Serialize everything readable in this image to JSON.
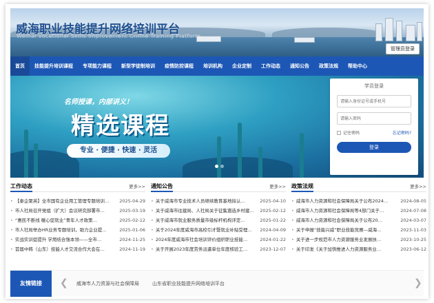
{
  "header": {
    "title": "威海职业技能提升网络培训平台",
    "subtitle": "Weihai Vocational Skills Improvement Online Training Platform",
    "admin_login": "管理员登录"
  },
  "nav": {
    "items": [
      "首页",
      "技能提升培训课程",
      "专项能力课程",
      "新型学徒制培训",
      "疫情防控课程",
      "培训机构",
      "企业定制",
      "工作动态",
      "通知公告",
      "政策法规",
      "帮助中心"
    ],
    "active_index": 0
  },
  "hero": {
    "slogan": "名师授课，内部讲义！",
    "headline": "精选课程",
    "tagline": "专业 · 便捷 · 快速 · 灵活",
    "slide_count": 2,
    "active_slide": 1
  },
  "login": {
    "title": "学员登录",
    "id_placeholder": "请输入身份证号或手机号",
    "password_placeholder": "请输入密码",
    "remember_label": "记住密码",
    "forgot_label": "忘记密码?",
    "submit_label": "登录"
  },
  "columns": [
    {
      "title": "工作动态",
      "more": "更多>>",
      "items": [
        {
          "title": "【泰企聚英】全市国有企业用工管理专题培训…",
          "date": "2025-04-29"
        },
        {
          "title": "市人社局召开党组（扩大）会议研究部署市…",
          "date": "2025-03-19"
        },
        {
          "title": "“惠民不断线 暖心促就业”青年人才政策…",
          "date": "2025-02-12"
        },
        {
          "title": "市人社局举办HR业务专题培训，助力企业提…",
          "date": "2025-01-06"
        },
        {
          "title": "实战实训促提升 学用结合强本领——全市…",
          "date": "2024-11-25"
        },
        {
          "title": "首届中韩（山东）技能人才交流合作大会在…",
          "date": "2024-11-19"
        }
      ]
    },
    {
      "title": "通知公告",
      "more": "更多>>",
      "items": [
        {
          "title": "关于威海市专业技术人员继续教育基地拟认…",
          "date": "2025-04-10"
        },
        {
          "title": "关于威海市往建局、人社局关于征集遴选乡村建…",
          "date": "2025-02-12"
        },
        {
          "title": "关于威海市就业服务质量市级标杆机构评定…",
          "date": "2025-01-22"
        },
        {
          "title": "关于2024年度威海市高校引才暨就业补贴受理…",
          "date": "2024-04-09"
        },
        {
          "title": "2024年度威海市社会培训评价组织职业技能…",
          "date": "2024-01-22"
        },
        {
          "title": "关于开展2023年度劳务派遣单位年度核验工…",
          "date": "2023-12-07"
        }
      ]
    },
    {
      "title": "政策法规",
      "more": "更多>>",
      "items": [
        {
          "title": "威海市人力资源和社会保障局关于公布2024…",
          "date": "2024-08-05"
        },
        {
          "title": "威海市人力资源和社会保障局等4部门关于…",
          "date": "2024-07-08"
        },
        {
          "title": "威海市人力资源和社会保障局关于公布20…",
          "date": "2024-03-07"
        },
        {
          "title": "关于申报“技能兴威”职业技能竞赛—威海…",
          "date": "2023-11-03"
        },
        {
          "title": "关于进一步规范市人力资源服务业发展扶…",
          "date": "2023-10-25"
        },
        {
          "title": "关于印发《关于加快推进人力资源服务业…",
          "date": "2023-06-12"
        }
      ]
    }
  ],
  "friend_links": {
    "label": "友情链接",
    "items": [
      "威海市人力资源与社会保障局",
      "山东省职业技能提升网络培训平台"
    ]
  }
}
